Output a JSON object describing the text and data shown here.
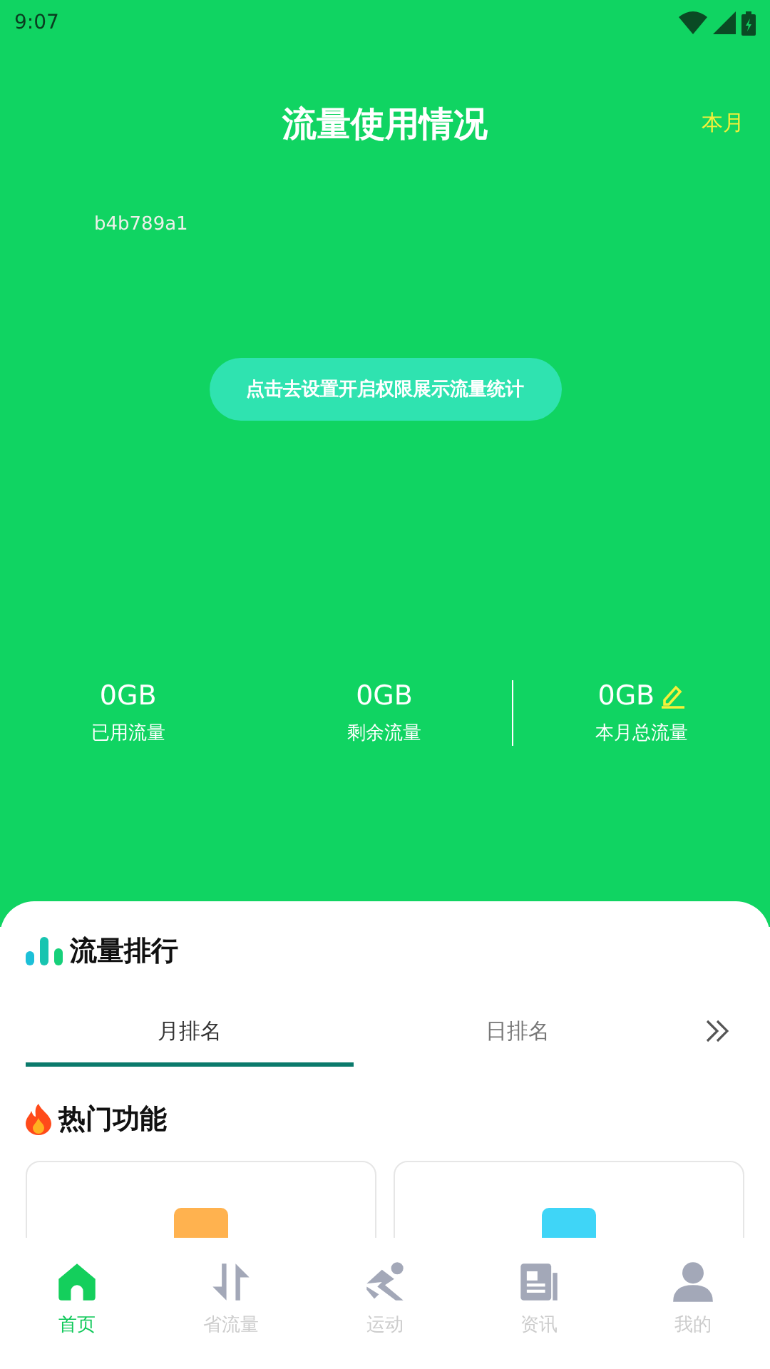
{
  "status_bar": {
    "time": "9:07"
  },
  "header": {
    "title": "流量使用情况",
    "period": "本月"
  },
  "device_id": "b4b789a1",
  "permission_button": "点击去设置开启权限展示流量统计",
  "stats": [
    {
      "value": "0GB",
      "label": "已用流量",
      "editable": false
    },
    {
      "value": "0GB",
      "label": "剩余流量",
      "editable": false
    },
    {
      "value": "0GB",
      "label": "本月总流量",
      "editable": true
    }
  ],
  "ranking": {
    "title": "流量排行",
    "tabs": [
      {
        "label": "月排名",
        "selected": true
      },
      {
        "label": "日排名",
        "selected": false
      }
    ]
  },
  "hot": {
    "title": "热门功能",
    "cards": [
      {
        "kind": "orange"
      },
      {
        "kind": "blue"
      }
    ]
  },
  "nav": [
    {
      "label": "首页",
      "kind": "home",
      "selected": true
    },
    {
      "label": "省流量",
      "kind": "swap",
      "selected": false
    },
    {
      "label": "运动",
      "kind": "run",
      "selected": false
    },
    {
      "label": "资讯",
      "kind": "news",
      "selected": false
    },
    {
      "label": "我的",
      "kind": "user",
      "selected": false
    }
  ]
}
